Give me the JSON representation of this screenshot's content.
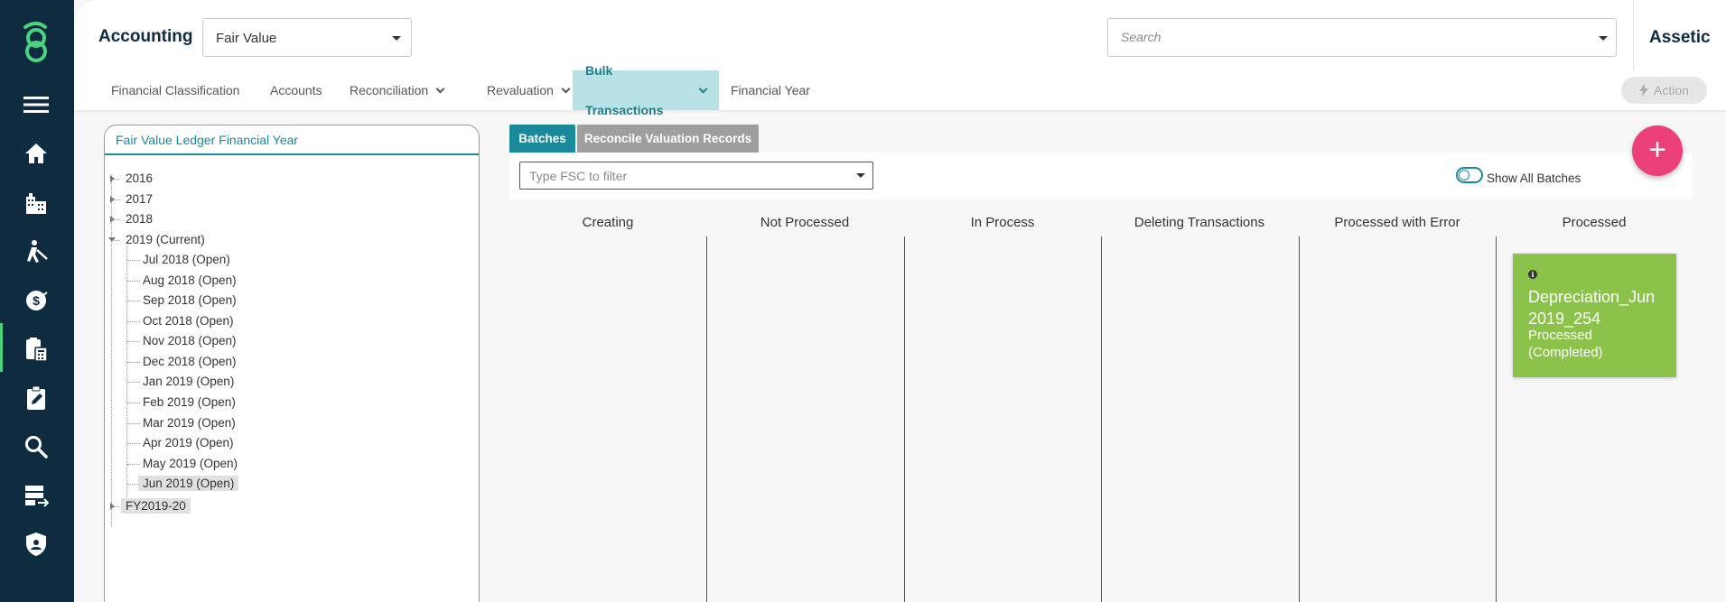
{
  "sidebar": {
    "items": [
      {
        "icon": "menu-icon"
      },
      {
        "icon": "home-icon"
      },
      {
        "icon": "buildings-icon"
      },
      {
        "icon": "worker-icon"
      },
      {
        "icon": "finance-icon"
      },
      {
        "icon": "accounting-icon",
        "active": true
      },
      {
        "icon": "clipboard-edit-icon"
      },
      {
        "icon": "search-icon"
      },
      {
        "icon": "data-transfer-icon"
      },
      {
        "icon": "shield-icon"
      }
    ],
    "accent": "#4cd37d",
    "background": "#0f2b40"
  },
  "header": {
    "module_title": "Accounting",
    "module_select_value": "Fair Value",
    "search_placeholder": "Search",
    "brand": "Assetic"
  },
  "subnav": {
    "tabs": [
      {
        "label": "Financial Classification",
        "dropdown": false
      },
      {
        "label": "Accounts",
        "dropdown": false
      },
      {
        "label": "Reconciliation",
        "dropdown": true
      },
      {
        "label": "Revaluation",
        "dropdown": true
      },
      {
        "label": "Bulk Transactions",
        "dropdown": true,
        "active": true
      },
      {
        "label": "Financial Year",
        "dropdown": false
      }
    ],
    "action_label": "Action"
  },
  "tree": {
    "title": "Fair Value Ledger Financial Year",
    "years": [
      {
        "label": "2016",
        "expanded": false
      },
      {
        "label": "2017",
        "expanded": false
      },
      {
        "label": "2018",
        "expanded": false
      },
      {
        "label": "2019 (Current)",
        "expanded": true,
        "months": [
          "Jul 2018 (Open)",
          "Aug 2018 (Open)",
          "Sep 2018 (Open)",
          "Oct 2018 (Open)",
          "Nov 2018 (Open)",
          "Dec 2018 (Open)",
          "Jan 2019 (Open)",
          "Feb 2019 (Open)",
          "Mar 2019 (Open)",
          "Apr 2019 (Open)",
          "May 2019 (Open)",
          "Jun 2019 (Open)"
        ],
        "selected_month": "Jun 2019 (Open)"
      },
      {
        "label": "FY2019-20",
        "expanded": false
      }
    ]
  },
  "batches": {
    "tabs": [
      {
        "label": "Batches",
        "active": true,
        "color": "#1a8a9a"
      },
      {
        "label": "Reconcile Valuation Records",
        "active": false,
        "color": "#9e9e9e"
      }
    ],
    "filter_placeholder": "Type FSC to filter",
    "show_all_label": "Show All Batches",
    "columns": [
      "Creating",
      "Not Processed",
      "In Process",
      "Deleting Transactions",
      "Processed with Error",
      "Processed"
    ],
    "cards": [
      {
        "column": "Processed",
        "title": "Depreciation_Jun 2019_254",
        "status": "Processed (Completed)",
        "color": "#8bc34a"
      }
    ],
    "fab_label": "+",
    "fab_color": "#ec407a"
  }
}
